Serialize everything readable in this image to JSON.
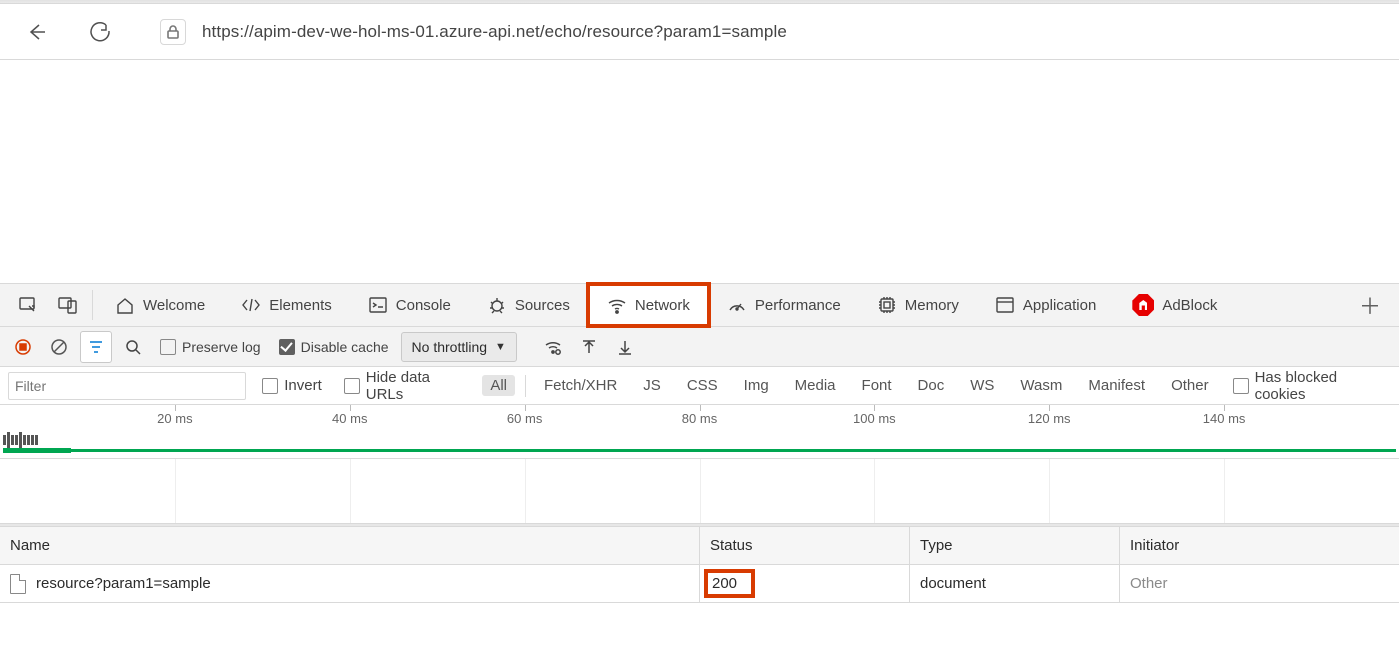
{
  "browser": {
    "url": "https://apim-dev-we-hol-ms-01.azure-api.net/echo/resource?param1=sample"
  },
  "devtools": {
    "tabs": {
      "welcome": "Welcome",
      "elements": "Elements",
      "console": "Console",
      "sources": "Sources",
      "network": "Network",
      "performance": "Performance",
      "memory": "Memory",
      "application": "Application",
      "adblock": "AdBlock"
    },
    "toolbar2": {
      "preserve_log": "Preserve log",
      "disable_cache": "Disable cache",
      "throttling": "No throttling"
    },
    "filters": {
      "placeholder": "Filter",
      "invert": "Invert",
      "hide_data_urls": "Hide data URLs",
      "types": [
        "All",
        "Fetch/XHR",
        "JS",
        "CSS",
        "Img",
        "Media",
        "Font",
        "Doc",
        "WS",
        "Wasm",
        "Manifest",
        "Other"
      ],
      "has_blocked": "Has blocked cookies"
    },
    "timeline": {
      "ticks": [
        "20 ms",
        "40 ms",
        "60 ms",
        "80 ms",
        "100 ms",
        "120 ms",
        "140 ms"
      ]
    },
    "table": {
      "headers": {
        "name": "Name",
        "status": "Status",
        "type": "Type",
        "initiator": "Initiator"
      },
      "rows": [
        {
          "name": "resource?param1=sample",
          "status": "200",
          "type": "document",
          "initiator": "Other"
        }
      ]
    }
  }
}
